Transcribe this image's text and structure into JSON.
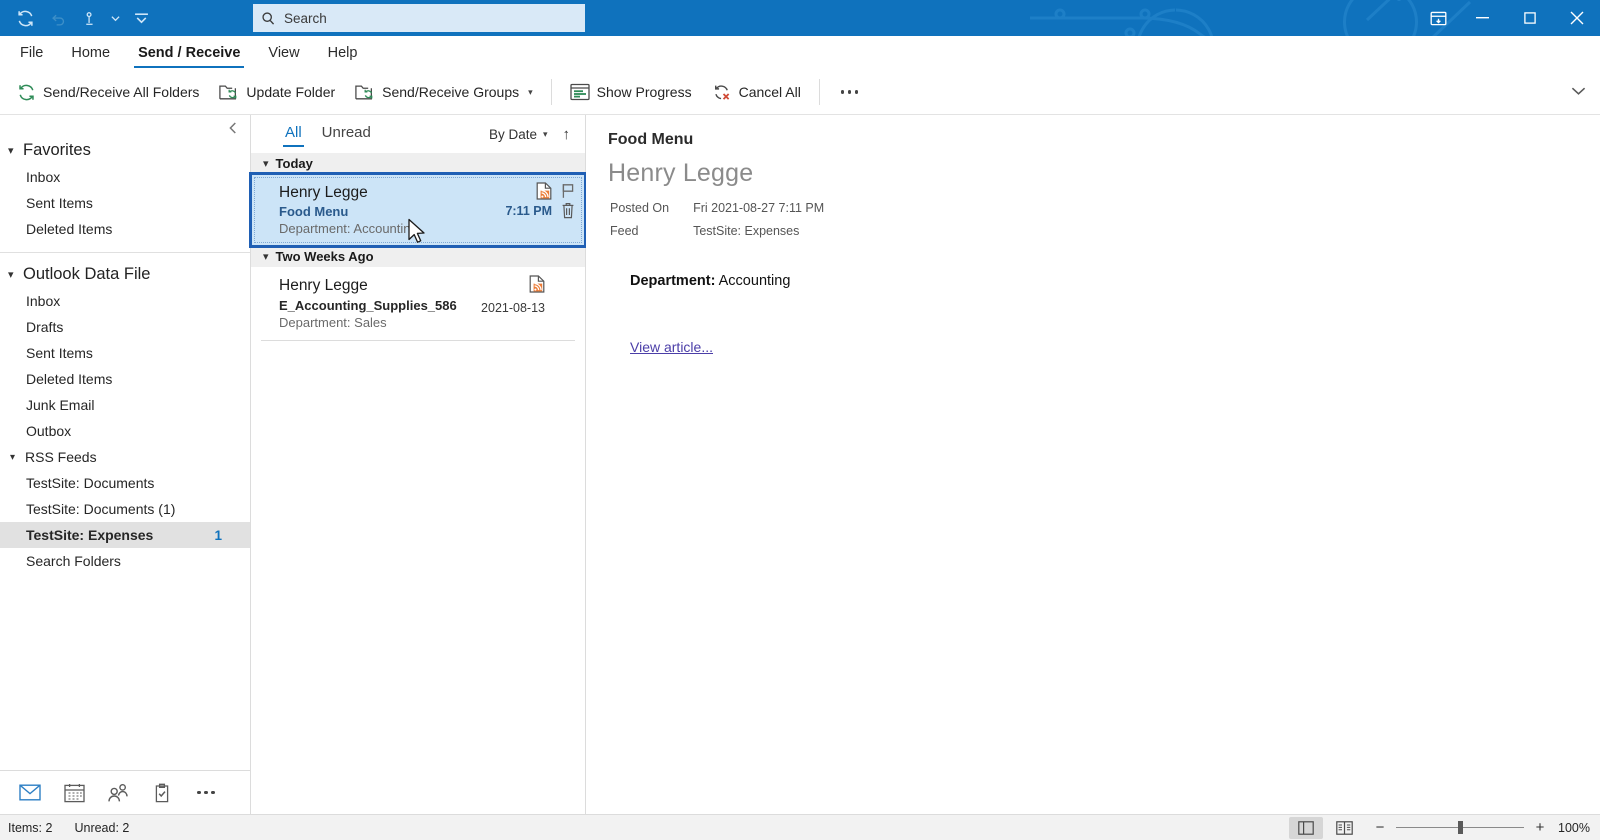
{
  "titlebar": {
    "quick_access": [
      {
        "name": "send-receive-all-icon",
        "label": "Send/Receive All Folders"
      },
      {
        "name": "undo-icon",
        "label": "Undo"
      },
      {
        "name": "touch-mode-icon",
        "label": "Touch/Mouse Mode"
      },
      {
        "name": "customize-quick-access-icon",
        "label": "Customize Quick Access Toolbar"
      }
    ],
    "search": {
      "placeholder": "Search"
    },
    "window_controls": [
      {
        "name": "ribbon-display-options",
        "label": "Ribbon Display Options"
      },
      {
        "name": "minimize",
        "label": "Minimize"
      },
      {
        "name": "maximize",
        "label": "Maximize"
      },
      {
        "name": "close",
        "label": "Close"
      }
    ],
    "accent_color": "#0f72bd"
  },
  "menu": {
    "tabs": [
      {
        "label": "File",
        "active": false
      },
      {
        "label": "Home",
        "active": false
      },
      {
        "label": "Send / Receive",
        "active": true
      },
      {
        "label": "View",
        "active": false
      },
      {
        "label": "Help",
        "active": false
      }
    ]
  },
  "ribbon": {
    "buttons": [
      {
        "label": "Send/Receive All Folders",
        "icon": "refresh-icon",
        "dropdown": false
      },
      {
        "label": "Update Folder",
        "icon": "update-folder-icon",
        "dropdown": false
      },
      {
        "label": "Send/Receive Groups",
        "icon": "send-receive-groups-icon",
        "dropdown": true
      },
      {
        "label": "Show Progress",
        "icon": "show-progress-icon",
        "dropdown": false
      },
      {
        "label": "Cancel All",
        "icon": "cancel-all-icon",
        "dropdown": false
      }
    ],
    "overflow_label": "More commands",
    "collapse_label": "Collapse the Ribbon"
  },
  "folder_pane": {
    "collapse_label": "Collapse the Folder Pane",
    "favorites": {
      "label": "Favorites",
      "items": [
        {
          "label": "Inbox"
        },
        {
          "label": "Sent Items"
        },
        {
          "label": "Deleted Items"
        }
      ]
    },
    "data_file": {
      "label": "Outlook Data File",
      "items": [
        {
          "label": "Inbox"
        },
        {
          "label": "Drafts"
        },
        {
          "label": "Sent Items"
        },
        {
          "label": "Deleted Items"
        },
        {
          "label": "Junk Email"
        },
        {
          "label": "Outbox"
        }
      ]
    },
    "rss": {
      "label": "RSS Feeds",
      "items": [
        {
          "label": "TestSite: Documents",
          "count": "",
          "selected": false
        },
        {
          "label": "TestSite: Documents (1)",
          "count": "",
          "selected": false
        },
        {
          "label": "TestSite: Expenses",
          "count": "1",
          "selected": true
        }
      ]
    },
    "search_folders": {
      "label": "Search Folders"
    },
    "nav_buttons": [
      {
        "name": "mail-icon",
        "label": "Mail",
        "active": true
      },
      {
        "name": "calendar-icon",
        "label": "Calendar",
        "active": false
      },
      {
        "name": "people-icon",
        "label": "People",
        "active": false
      },
      {
        "name": "tasks-icon",
        "label": "Tasks",
        "active": false
      },
      {
        "name": "more-nav-icon",
        "label": "More",
        "active": false
      }
    ]
  },
  "message_list": {
    "filters": [
      {
        "label": "All",
        "active": true
      },
      {
        "label": "Unread",
        "active": false
      }
    ],
    "sort_label": "By Date",
    "sort_direction_icon": "arrow-up-icon",
    "groups": [
      {
        "header": "Today",
        "messages": [
          {
            "sender": "Henry Legge",
            "subject": "Food Menu",
            "preview": "Department: Accounting",
            "time": "7:11 PM",
            "selected": true,
            "icons": [
              "rss-document-icon",
              "flag-icon",
              "delete-icon"
            ]
          }
        ]
      },
      {
        "header": "Two Weeks Ago",
        "messages": [
          {
            "sender": "Henry Legge",
            "subject": "E_Accounting_Supplies_586",
            "preview": "Department: Sales",
            "time": "2021-08-13",
            "selected": false,
            "icons": [
              "rss-document-icon"
            ]
          }
        ]
      }
    ]
  },
  "reading_pane": {
    "subject": "Food Menu",
    "sender": "Henry Legge",
    "fields": [
      {
        "label": "Posted On",
        "value": "Fri 2021-08-27 7:11 PM"
      },
      {
        "label": "Feed",
        "value": "TestSite: Expenses"
      }
    ],
    "body_label": "Department:",
    "body_value": "Accounting",
    "link_label": "View article..."
  },
  "status_bar": {
    "items_text": "Items: 2",
    "unread_text": "Unread: 2",
    "view_buttons": [
      {
        "name": "normal-view-icon",
        "label": "Normal",
        "active": true
      },
      {
        "name": "reading-view-icon",
        "label": "Reading",
        "active": false
      }
    ],
    "zoom_out_label": "−",
    "zoom_in_label": "+",
    "zoom_level": "100%"
  }
}
